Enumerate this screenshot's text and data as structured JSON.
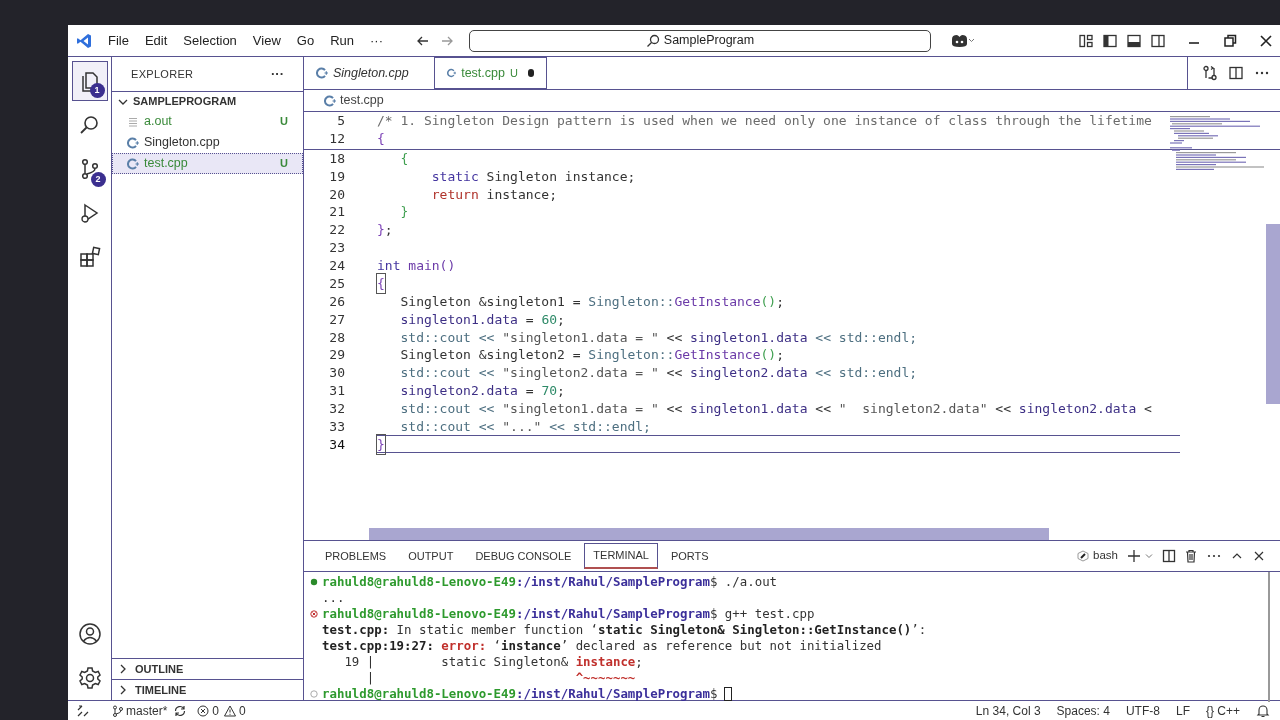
{
  "menu": [
    "File",
    "Edit",
    "Selection",
    "View",
    "Go",
    "Run",
    "···"
  ],
  "command_center": {
    "text": "SampleProgram"
  },
  "activity_bar": [
    {
      "kind": "explorer",
      "selected": true,
      "badge": "1"
    },
    {
      "kind": "search",
      "selected": false
    },
    {
      "kind": "source_control",
      "selected": false,
      "badge": "2"
    },
    {
      "kind": "run",
      "selected": false
    },
    {
      "kind": "extensions",
      "selected": false
    }
  ],
  "sidebar": {
    "title": "EXPLORER",
    "more": "···",
    "folder": {
      "name": "SAMPLEPROGRAM",
      "expanded": true,
      "files": [
        {
          "name": "a.out",
          "kind": "binary",
          "status": "U",
          "selected": false
        },
        {
          "name": "Singleton.cpp",
          "kind": "cpp",
          "selected": false
        },
        {
          "name": "test.cpp",
          "kind": "cpp",
          "status": "U",
          "selected": true
        }
      ]
    },
    "sections": [
      {
        "name": "OUTLINE",
        "expanded": false
      },
      {
        "name": "TIMELINE",
        "expanded": false
      }
    ]
  },
  "tabs": [
    {
      "label": "Singleton.cpp",
      "preview": true,
      "selected": false,
      "modified": false
    },
    {
      "label": "test.cpp",
      "status": "U",
      "preview": false,
      "selected": true,
      "modified": true
    }
  ],
  "breadcrumb": [
    "test.cpp"
  ],
  "editor": {
    "sticky": [
      {
        "number": "5",
        "current": false,
        "segments": [
          {
            "text": "/* 1. Singleton Design pattern is used when we need only one instance of class through the lifetime",
            "kind": "comment"
          }
        ]
      },
      {
        "number": "12",
        "current": false,
        "segments": [
          {
            "text": "{",
            "kind": "brace1"
          }
        ]
      }
    ],
    "lines": [
      {
        "number": "18",
        "current": false,
        "segments": [
          {
            "text": "   {",
            "kind": "brace2"
          }
        ]
      },
      {
        "number": "19",
        "current": false,
        "segments": [
          {
            "text": "       static",
            "kind": "keyword"
          },
          {
            "text": " Singleton instance;",
            "kind": "plain"
          }
        ]
      },
      {
        "number": "20",
        "current": false,
        "segments": [
          {
            "text": "       return",
            "kind": "control"
          },
          {
            "text": " instance;",
            "kind": "plain"
          }
        ]
      },
      {
        "number": "21",
        "current": false,
        "segments": [
          {
            "text": "   }",
            "kind": "brace2"
          }
        ]
      },
      {
        "number": "22",
        "current": false,
        "segments": [
          {
            "text": "}",
            "kind": "brace1"
          },
          {
            "text": ";",
            "kind": "plain"
          }
        ]
      },
      {
        "number": "23",
        "current": false
      },
      {
        "number": "24",
        "current": false,
        "segments": [
          {
            "text": "int",
            "kind": "keyword"
          },
          {
            "text": " main()",
            "kind": "func"
          }
        ]
      },
      {
        "number": "25",
        "current": false,
        "bracket": true,
        "segments": [
          {
            "text": "{",
            "kind": "brace1"
          }
        ]
      },
      {
        "number": "26",
        "current": false,
        "segments": [
          {
            "text": "   Singleton &singleton1 = ",
            "kind": "plain"
          },
          {
            "text": "Singleton::",
            "kind": "scope"
          },
          {
            "text": "GetInstance",
            "kind": "func"
          },
          {
            "text": "()",
            "kind": "brace2"
          },
          {
            "text": ";",
            "kind": "plain"
          }
        ]
      },
      {
        "number": "27",
        "current": false,
        "segments": [
          {
            "text": "   singleton1.data",
            "kind": "ident"
          },
          {
            "text": " = ",
            "kind": "plain"
          },
          {
            "text": "60",
            "kind": "number"
          },
          {
            "text": ";",
            "kind": "plain"
          }
        ]
      },
      {
        "number": "28",
        "current": false,
        "segments": [
          {
            "text": "   std::cout << ",
            "kind": "scope"
          },
          {
            "text": "\"singleton1.data = \"",
            "kind": "string"
          },
          {
            "text": " << ",
            "kind": "plain"
          },
          {
            "text": "singleton1.data",
            "kind": "ident"
          },
          {
            "text": " << std::endl;",
            "kind": "scope"
          }
        ]
      },
      {
        "number": "29",
        "current": false,
        "segments": [
          {
            "text": "   Singleton &singleton2 = ",
            "kind": "plain"
          },
          {
            "text": "Singleton::",
            "kind": "scope"
          },
          {
            "text": "GetInstance",
            "kind": "func"
          },
          {
            "text": "()",
            "kind": "brace2"
          },
          {
            "text": ";",
            "kind": "plain"
          }
        ]
      },
      {
        "number": "30",
        "current": false,
        "segments": [
          {
            "text": "   std::cout << ",
            "kind": "scope"
          },
          {
            "text": "\"singleton2.data = \"",
            "kind": "string"
          },
          {
            "text": " << ",
            "kind": "plain"
          },
          {
            "text": "singleton2.data",
            "kind": "ident"
          },
          {
            "text": " << std::endl;",
            "kind": "scope"
          }
        ]
      },
      {
        "number": "31",
        "current": false,
        "segments": [
          {
            "text": "   singleton2.data",
            "kind": "ident"
          },
          {
            "text": " = ",
            "kind": "plain"
          },
          {
            "text": "70",
            "kind": "number"
          },
          {
            "text": ";",
            "kind": "plain"
          }
        ]
      },
      {
        "number": "32",
        "current": false,
        "segments": [
          {
            "text": "   std::cout << ",
            "kind": "scope"
          },
          {
            "text": "\"singleton1.data = \"",
            "kind": "string"
          },
          {
            "text": " << ",
            "kind": "plain"
          },
          {
            "text": "singleton1.data",
            "kind": "ident"
          },
          {
            "text": " << ",
            "kind": "plain"
          },
          {
            "text": "\"  singleton2.data\"",
            "kind": "string"
          },
          {
            "text": " << ",
            "kind": "plain"
          },
          {
            "text": "singleton2.data",
            "kind": "ident"
          },
          {
            "text": " <",
            "kind": "plain"
          }
        ]
      },
      {
        "number": "33",
        "current": false,
        "segments": [
          {
            "text": "   std::cout << ",
            "kind": "scope"
          },
          {
            "text": "\"...\"",
            "kind": "string"
          },
          {
            "text": " << std::endl;",
            "kind": "scope"
          }
        ]
      },
      {
        "number": "34",
        "current": true,
        "bracket": true,
        "segments": [
          {
            "text": "}",
            "kind": "brace1"
          }
        ]
      }
    ]
  },
  "panel": {
    "tabs": [
      {
        "label": "PROBLEMS",
        "selected": false
      },
      {
        "label": "OUTPUT",
        "selected": false
      },
      {
        "label": "DEBUG CONSOLE",
        "selected": false
      },
      {
        "label": "TERMINAL",
        "selected": true
      },
      {
        "label": "PORTS",
        "selected": false
      }
    ],
    "shell": "bash",
    "terminal": [
      {
        "kind": "success_prompt",
        "user": "rahuld8@rahuld8-Lenovo-E49",
        "path": ":/inst/Rahul/SampleProgram",
        "command": "$ ./a.out",
        "cursor": false
      },
      {
        "kind": "output",
        "segments": [
          {
            "text": "...",
            "kind": "plain"
          }
        ]
      },
      {
        "kind": "error_prompt",
        "user": "rahuld8@rahuld8-Lenovo-E49",
        "path": ":/inst/Rahul/SampleProgram",
        "command": "$ g++ test.cpp",
        "cursor": false
      },
      {
        "kind": "output",
        "segments": [
          {
            "text": "test.cpp:",
            "kind": "bold"
          },
          {
            "text": " In static member function ‘",
            "kind": "plain"
          },
          {
            "text": "static Singleton& Singleton::GetInstance()",
            "kind": "bold"
          },
          {
            "text": "’:",
            "kind": "plain"
          }
        ]
      },
      {
        "kind": "output",
        "segments": [
          {
            "text": "test.cpp:19:27: ",
            "kind": "bold"
          },
          {
            "text": "error: ",
            "kind": "error"
          },
          {
            "text": "‘",
            "kind": "plain"
          },
          {
            "text": "instance",
            "kind": "bold"
          },
          {
            "text": "’ declared as reference but not initialized",
            "kind": "plain"
          }
        ]
      },
      {
        "kind": "output",
        "segments": [
          {
            "text": "   19 |         static Singleton& ",
            "kind": "plain"
          },
          {
            "text": "instance",
            "kind": "error"
          },
          {
            "text": ";",
            "kind": "plain"
          }
        ]
      },
      {
        "kind": "output",
        "segments": [
          {
            "text": "      |                           ",
            "kind": "plain"
          },
          {
            "text": "^~~~~~~~",
            "kind": "error"
          }
        ]
      },
      {
        "kind": "idle_prompt",
        "user": "rahuld8@rahuld8-Lenovo-E49",
        "path": ":/inst/Rahul/SampleProgram",
        "command": "$",
        "cursor": true
      }
    ]
  },
  "status_bar": {
    "branch": "master*",
    "errors": "0",
    "warnings": "0",
    "right": [
      "Ln 34, Col 3",
      "Spaces: 4",
      "UTF-8",
      "LF",
      "{} C++"
    ]
  }
}
